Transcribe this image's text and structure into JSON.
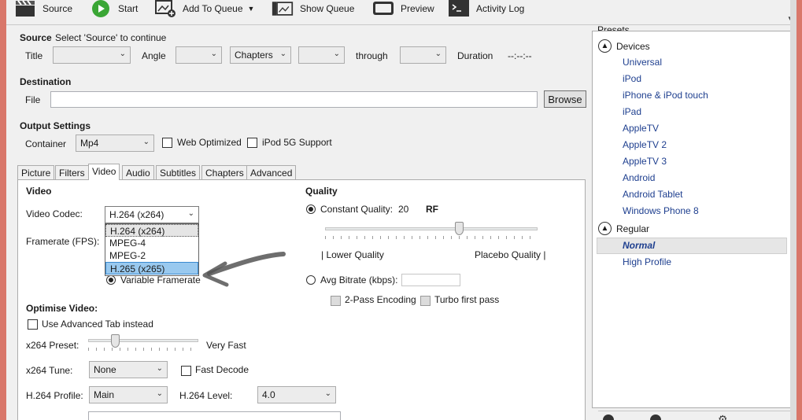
{
  "toolbar": {
    "source": "Source",
    "start": "Start",
    "add_to_queue": "Add To Queue",
    "show_queue": "Show Queue",
    "preview": "Preview",
    "activity_log": "Activity Log"
  },
  "source": {
    "label": "Source",
    "hint": "Select 'Source' to continue",
    "title_label": "Title",
    "angle_label": "Angle",
    "mode_value": "Chapters",
    "through_label": "through",
    "duration_label": "Duration",
    "duration_value": "--:--:--"
  },
  "destination": {
    "heading": "Destination",
    "file_label": "File",
    "file_value": "",
    "browse": "Browse"
  },
  "output": {
    "heading": "Output Settings",
    "container_label": "Container",
    "container_value": "Mp4",
    "web_optimized": "Web Optimized",
    "ipod_support": "iPod 5G Support"
  },
  "tabs": [
    "Picture",
    "Filters",
    "Video",
    "Audio",
    "Subtitles",
    "Chapters",
    "Advanced"
  ],
  "active_tab": "Video",
  "video": {
    "heading": "Video",
    "codec_label": "Video Codec:",
    "codec_value": "H.264 (x264)",
    "codec_options": [
      "H.264 (x264)",
      "MPEG-4",
      "MPEG-2",
      "H.265 (x265)"
    ],
    "codec_highlighted": "H.265 (x265)",
    "framerate_label": "Framerate (FPS):",
    "variable_framerate": "Variable Framerate"
  },
  "quality": {
    "heading": "Quality",
    "constant_label": "Constant Quality:",
    "constant_value": "20",
    "rf_label": "RF",
    "low_label": "| Lower Quality",
    "high_label": "Placebo Quality |",
    "avg_bitrate_label": "Avg Bitrate (kbps):",
    "two_pass": "2-Pass Encoding",
    "turbo": "Turbo first pass",
    "slider_position": 0.63
  },
  "optimise": {
    "heading": "Optimise Video:",
    "use_advanced": "Use Advanced Tab instead",
    "preset_label": "x264 Preset:",
    "preset_value": "Very Fast",
    "tune_label": "x264 Tune:",
    "tune_value": "None",
    "fast_decode": "Fast Decode",
    "profile_label": "H.264 Profile:",
    "profile_value": "Main",
    "level_label": "H.264 Level:",
    "level_value": "4.0",
    "preset_slider_position": 0.24
  },
  "presets": {
    "heading": "Presets",
    "groups": [
      {
        "name": "Devices",
        "items": [
          "Universal",
          "iPod",
          "iPhone & iPod touch",
          "iPad",
          "AppleTV",
          "AppleTV 2",
          "AppleTV 3",
          "Android",
          "Android Tablet",
          "Windows Phone 8"
        ]
      },
      {
        "name": "Regular",
        "items": [
          "Normal",
          "High Profile"
        ]
      }
    ],
    "selected": "Normal"
  },
  "colors": {
    "accent_highlight": "#99c9ef",
    "preset_text": "#1e3f8f",
    "start_green": "#3aa635"
  }
}
